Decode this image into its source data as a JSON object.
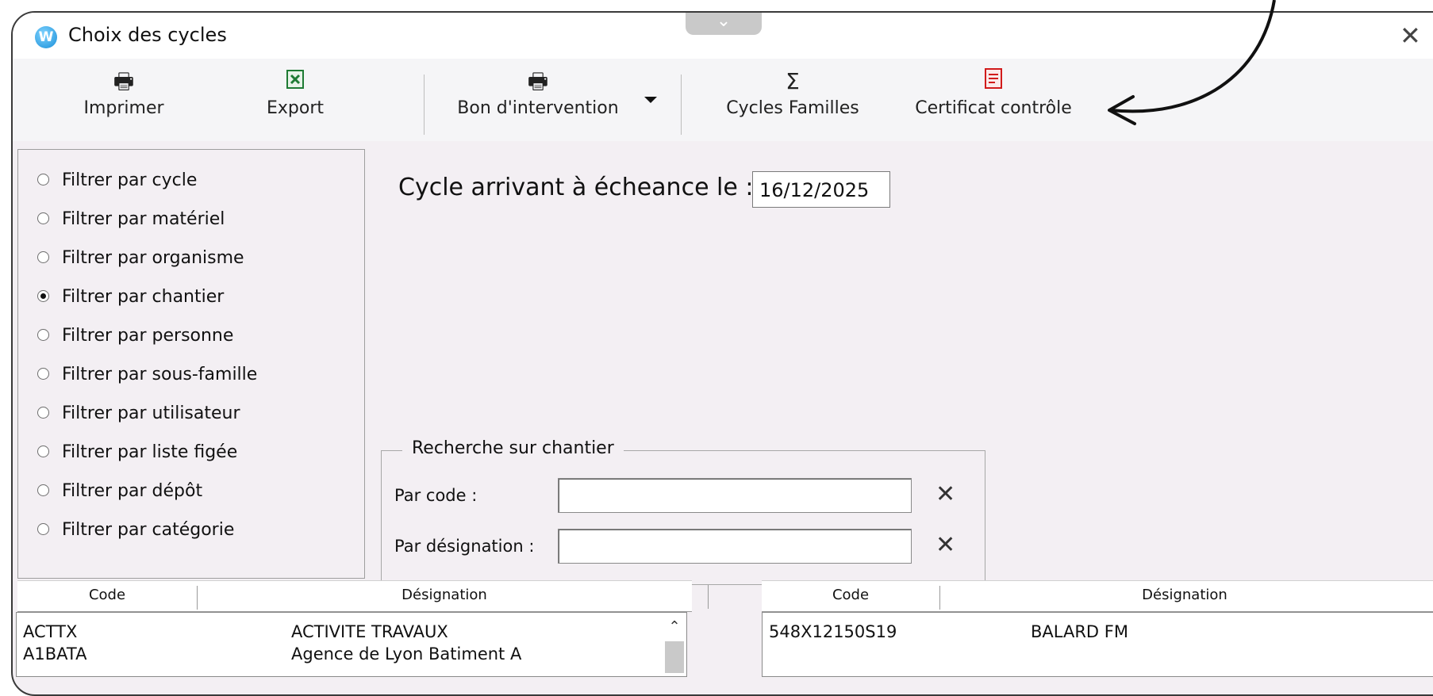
{
  "window": {
    "title": "Choix des cycles",
    "close_symbol": "✕",
    "collapse_symbol": "⌄"
  },
  "toolbar": {
    "print_label": "Imprimer",
    "export_label": "Export",
    "intervention_label": "Bon d'intervention",
    "cycles_families_label": "Cycles Familles",
    "cycles_families_symbol": "Σ",
    "certificate_label": "Certificat contrôle"
  },
  "filters": [
    {
      "label": "Filtrer par cycle",
      "checked": false
    },
    {
      "label": "Filtrer par matériel",
      "checked": false
    },
    {
      "label": "Filtrer par organisme",
      "checked": false
    },
    {
      "label": "Filtrer par chantier",
      "checked": true
    },
    {
      "label": "Filtrer par personne",
      "checked": false
    },
    {
      "label": "Filtrer par sous-famille",
      "checked": false
    },
    {
      "label": "Filtrer par utilisateur",
      "checked": false
    },
    {
      "label": "Filtrer par liste figée",
      "checked": false
    },
    {
      "label": "Filtrer par dépôt",
      "checked": false
    },
    {
      "label": "Filtrer par catégorie",
      "checked": false
    }
  ],
  "due": {
    "label": "Cycle arrivant à écheance le :",
    "value": "16/12/2025"
  },
  "search": {
    "legend": "Recherche sur chantier",
    "code_label": "Par code :",
    "code_value": "",
    "designation_label": "Par désignation :",
    "designation_value": "",
    "clear_symbol": "✕"
  },
  "left_grid": {
    "headers": [
      "Code",
      "Désignation"
    ],
    "rows": [
      {
        "code": "ACTTX",
        "designation": "ACTIVITE TRAVAUX"
      },
      {
        "code": "A1BATA",
        "designation": "Agence de Lyon Batiment A"
      }
    ]
  },
  "right_grid": {
    "headers": [
      "Code",
      "Désignation"
    ],
    "rows": [
      {
        "code": "548X12150S19",
        "designation": "BALARD FM"
      }
    ]
  },
  "colors": {
    "window_bg": "#f3eff3",
    "accent": "#1a8fd8",
    "pdf_red": "#d11b1b",
    "excel_green": "#1e7b34"
  }
}
